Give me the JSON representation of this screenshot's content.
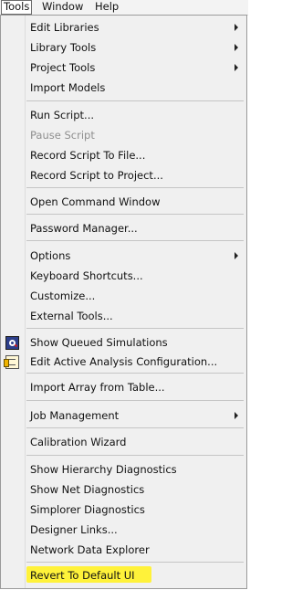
{
  "menubar": {
    "items": [
      {
        "label": "Tools"
      },
      {
        "label": "Window"
      },
      {
        "label": "Help"
      }
    ]
  },
  "tools_menu": {
    "items": [
      {
        "label": "Edit Libraries"
      },
      {
        "label": "Library Tools"
      },
      {
        "label": "Project Tools"
      },
      {
        "label": "Import Models"
      },
      {
        "label": "Run Script..."
      },
      {
        "label": "Pause Script"
      },
      {
        "label": "Record Script To File..."
      },
      {
        "label": "Record Script to Project..."
      },
      {
        "label": "Open Command Window"
      },
      {
        "label": "Password Manager..."
      },
      {
        "label": "Options"
      },
      {
        "label": "Keyboard Shortcuts..."
      },
      {
        "label": "Customize..."
      },
      {
        "label": "External Tools..."
      },
      {
        "label": "Show Queued Simulations"
      },
      {
        "label": "Edit Active Analysis Configuration..."
      },
      {
        "label": "Import Array from Table..."
      },
      {
        "label": "Job Management"
      },
      {
        "label": "Calibration Wizard"
      },
      {
        "label": "Show Hierarchy Diagnostics"
      },
      {
        "label": "Show Net Diagnostics"
      },
      {
        "label": "Simplorer Diagnostics"
      },
      {
        "label": "Designer Links..."
      },
      {
        "label": "Network Data Explorer"
      },
      {
        "label": "Revert To Default UI"
      }
    ]
  },
  "icons": {
    "queued_simulations": "queued-simulations-icon",
    "analysis_configuration": "analysis-configuration-icon"
  },
  "colors": {
    "highlight": "#fff23a",
    "menu_background": "#f0f0f0",
    "disabled_text": "#8f8f8f"
  }
}
